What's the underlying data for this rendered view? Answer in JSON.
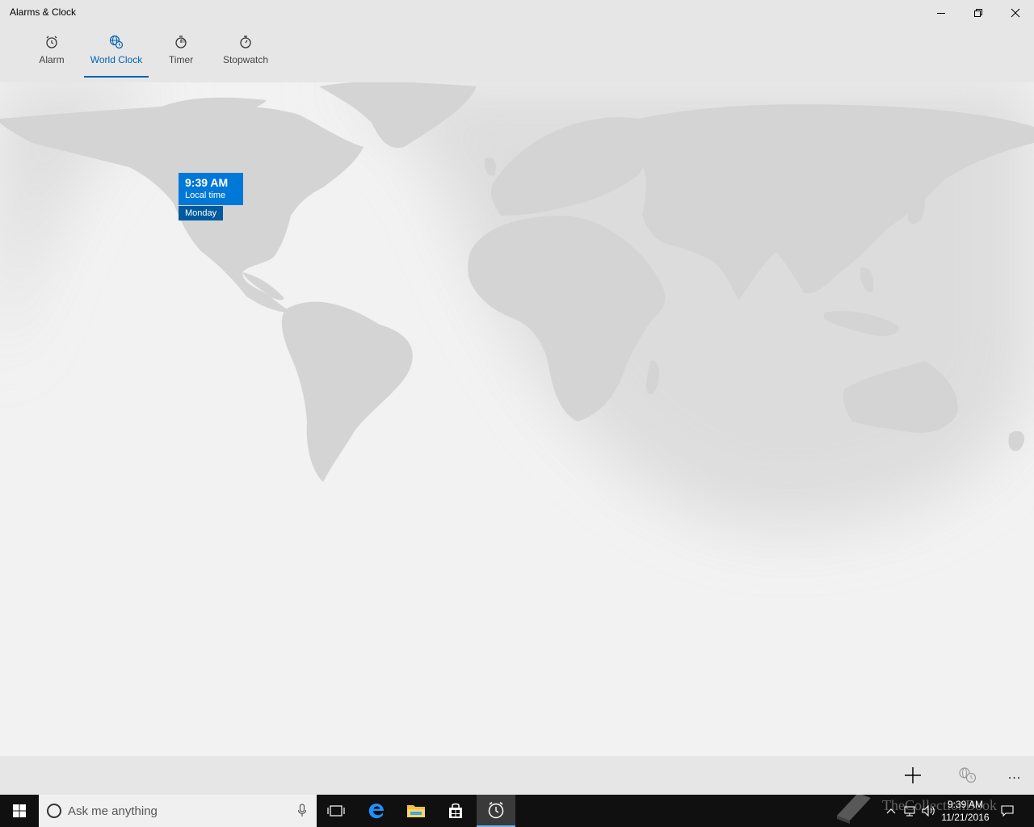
{
  "window": {
    "title": "Alarms & Clock",
    "controls": {
      "minimize": "minimize",
      "restore": "restore",
      "close": "close"
    }
  },
  "nav": {
    "tabs": [
      {
        "label": "Alarm",
        "icon": "alarm-icon",
        "active": false
      },
      {
        "label": "World Clock",
        "icon": "globe-clock-icon",
        "active": true
      },
      {
        "label": "Timer",
        "icon": "timer-icon",
        "active": false
      },
      {
        "label": "Stopwatch",
        "icon": "stopwatch-icon",
        "active": false
      }
    ]
  },
  "map": {
    "local_clock": {
      "time": "9:39 AM",
      "label": "Local time",
      "day": "Monday"
    }
  },
  "commandbar": {
    "add": "add-icon",
    "compare": "compare-clocks-icon",
    "more": "..."
  },
  "taskbar": {
    "search_placeholder": "Ask me anything",
    "time": "9:39 AM",
    "date": "11/21/2016",
    "watermark": "TheCollectionBook"
  },
  "colors": {
    "accent": "#0078d7",
    "accent_dark": "#005a9e",
    "active_tab": "#0063b1"
  }
}
